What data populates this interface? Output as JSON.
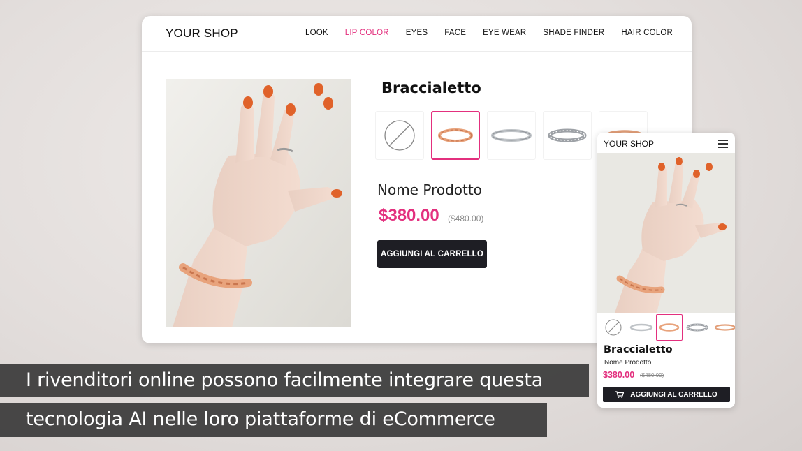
{
  "desktop": {
    "logo": "YOUR SHOP",
    "nav": [
      "LOOK",
      "LIP COLOR",
      "EYES",
      "FACE",
      "EYE WEAR",
      "SHADE FINDER",
      "HAIR COLOR"
    ],
    "nav_active": "LIP COLOR",
    "category_title": "Braccialetto",
    "product_name": "Nome Prodotto",
    "price": "$380.00",
    "old_price": "($480.00)",
    "add_to_cart": "AGGIUNGI AL CARRELLO"
  },
  "mobile": {
    "logo": "YOUR SHOP",
    "category_title": "Braccialetto",
    "product_name": "Nome Prodotto",
    "price": "$380.00",
    "old_price": "($480.00)",
    "add_to_cart": "AGGIUNGI AL CARRELLO"
  },
  "captions": {
    "line1": "I rivenditori online possono facilmente integrare questa",
    "line2": "tecnologia AI nelle loro piattaforme di eCommerce"
  },
  "colors": {
    "accent": "#e3307e",
    "button_bg": "#1e1e24",
    "caption_bg": "#3a3a3a"
  },
  "icons": {
    "none_swatch": "no-bracelet-icon",
    "menu": "hamburger-menu-icon",
    "cart": "cart-icon"
  }
}
